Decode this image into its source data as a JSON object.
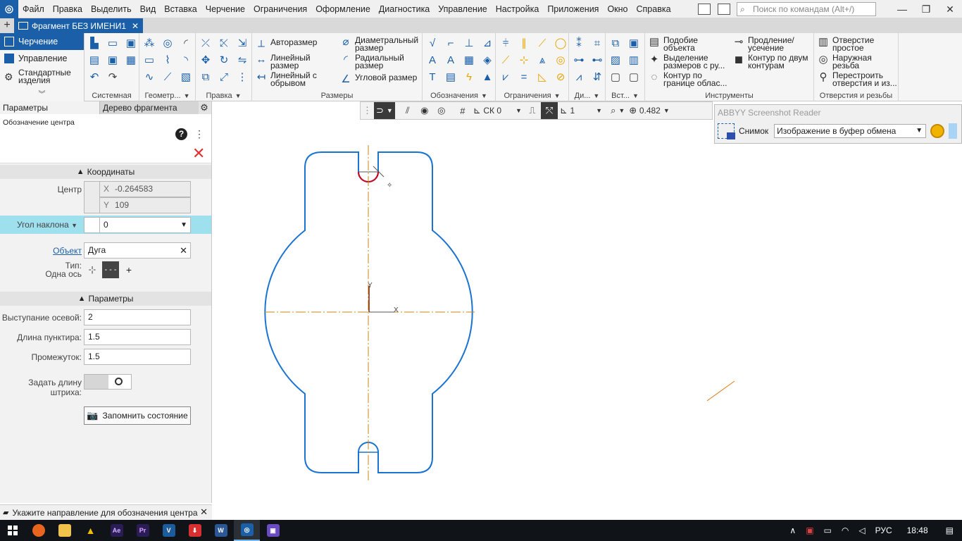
{
  "menubar": {
    "items": [
      "Файл",
      "Правка",
      "Выделить",
      "Вид",
      "Вставка",
      "Черчение",
      "Ограничения",
      "Оформление",
      "Диагностика",
      "Управление",
      "Настройка",
      "Приложения",
      "Окно",
      "Справка"
    ],
    "search_placeholder": "Поиск по командам (Alt+/)"
  },
  "tabs": {
    "document_tab": "Фрагмент БЕЗ ИМЕНИ1"
  },
  "ribbon": {
    "modes": [
      "Черчение",
      "Управление",
      "Стандартные изделия"
    ],
    "groups": {
      "system": "Системная",
      "geometry": "Геометр...",
      "edit": "Правка",
      "dimensions": "Размеры",
      "designations": "Обозначения",
      "constraints": "Ограничения",
      "di": "Ди...",
      "insert": "Вст...",
      "tools": "Инструменты",
      "holes": "Отверстия и резьбы"
    },
    "dim_buttons": {
      "auto": "Авторазмер",
      "linear": "Линейный размер",
      "linear_break": "Линейный с обрывом",
      "diameter": "Диаметральный размер",
      "radial": "Радиальный размер",
      "angular": "Угловой размер"
    },
    "tool_buttons": {
      "similar": "Подобие объекта",
      "select_dims": "Выделение размеров с ру...",
      "contour_boundary": "Контур по границе облас...",
      "extend": "Продление/ усечение",
      "contour_two": "Контур по двум контурам"
    },
    "hole_buttons": {
      "simple": "Отверстие простое",
      "thread": "Наружная резьба",
      "rebuild": "Перестроить отверстия и из..."
    }
  },
  "left_panel": {
    "tab_params": "Параметры",
    "tab_tree": "Дерево фрагмента",
    "command_name": "Обозначение центра",
    "section_coords": "Координаты",
    "center_label": "Центр",
    "x_prefix": "X",
    "x_value": "-0.264583",
    "y_prefix": "Y",
    "y_value": "109",
    "angle_label": "Угол наклона",
    "angle_value": "0",
    "object_label": "Объект",
    "object_value": "Дуга",
    "type_label_1": "Тип:",
    "type_label_2": "Одна ось",
    "type_opt_1": "-¦-",
    "type_opt_2": "- - -",
    "type_opt_3": "+",
    "section_params": "Параметры",
    "overhang_label": "Выступание осевой:",
    "overhang_value": "2",
    "dash_len_label": "Длина пунктира:",
    "dash_len_value": "1.5",
    "gap_label": "Промежуток:",
    "gap_value": "1.5",
    "stroke_len_label": "Задать длину штриха:",
    "save_state_label": "Запомнить состояние"
  },
  "hint": "Укажите направление для обозначения центра",
  "view_toolbar": {
    "cs": "СК 0",
    "layer": "1",
    "zoom": "0.482"
  },
  "canvas": {
    "axis_x": "X",
    "axis_y": "Y"
  },
  "abbyy": {
    "title": "ABBYY Screenshot Reader",
    "snap_label": "Снимок",
    "mode_value": "Изображение в буфер обмена"
  },
  "taskbar": {
    "lang": "РУС",
    "time": "18:48"
  },
  "colors": {
    "accent": "#1b5fa8",
    "contour": "#1a73d1",
    "axis": "#c8861a",
    "highlight": "#d0021b",
    "angle_row": "#9fe0ef"
  }
}
